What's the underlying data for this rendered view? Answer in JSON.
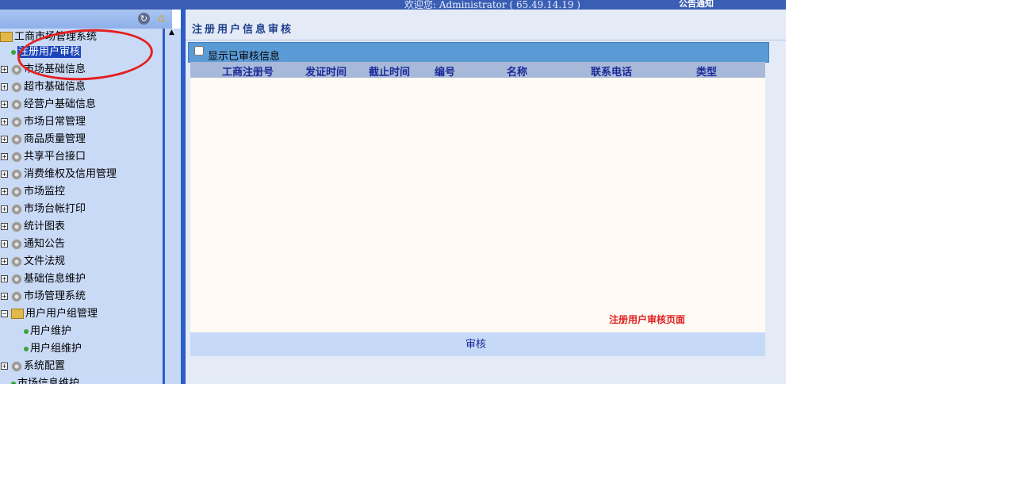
{
  "header": {
    "welcome": "欢迎您: Administrator ( 65.49.14.19 )",
    "notice": "公告通知"
  },
  "left_toolbar": {
    "icons": [
      "refresh-icon",
      "home-icon"
    ]
  },
  "tree": {
    "root": "工商市场管理系统",
    "selected_child": "注册用户审核",
    "nodes": [
      "市场基础信息",
      "超市基础信息",
      "经营户基础信息",
      "市场日常管理",
      "商品质量管理",
      "共享平台接口",
      "消费维权及信用管理",
      "市场监控",
      "市场台帐打印",
      "统计图表",
      "通知公告",
      "文件法规",
      "基础信息维护",
      "市场管理系统",
      "用户用户组管理"
    ],
    "user_group_children": [
      "用户维护",
      "用户组维护"
    ],
    "after": "系统配置",
    "partial": "市场信息维护"
  },
  "main": {
    "title": "注册用户信息审核",
    "filter_label": "显示已审核信息",
    "columns": [
      "工商注册号",
      "发证时间",
      "截止时间",
      "编号",
      "名称",
      "联系电话",
      "类型"
    ],
    "note": "注册用户审核页面",
    "review_label": "审核"
  },
  "colors": {
    "top_bar": "#3a5eb3",
    "tree_bg": "#c9daf7",
    "accent_border": "#2c5cc5",
    "filter_bar": "#5b9bd5",
    "grid_header": "#a8b8d8",
    "note_red": "#e02020"
  }
}
